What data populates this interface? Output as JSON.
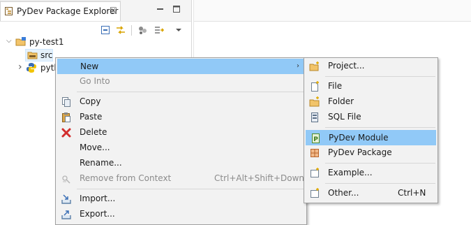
{
  "view": {
    "tab_title": "PyDev Package Explorer",
    "tab_close": "☒"
  },
  "tree": {
    "project": {
      "label": "py-test1",
      "twist": "⌵"
    },
    "src": {
      "label": "src"
    },
    "python": {
      "label": "pytl",
      "twist": "›"
    }
  },
  "context_menu": {
    "items": [
      {
        "label": "New",
        "submenu_arrow": "›"
      },
      {
        "label": "Go Into"
      },
      {
        "label": "Copy"
      },
      {
        "label": "Paste"
      },
      {
        "label": "Delete"
      },
      {
        "label": "Move..."
      },
      {
        "label": "Rename..."
      },
      {
        "label": "Remove from Context",
        "accelerator": "Ctrl+Alt+Shift+Down"
      },
      {
        "label": "Import..."
      },
      {
        "label": "Export..."
      }
    ]
  },
  "new_submenu": {
    "items": [
      {
        "label": "Project..."
      },
      {
        "label": "File"
      },
      {
        "label": "Folder"
      },
      {
        "label": "SQL File"
      },
      {
        "label": "PyDev Module"
      },
      {
        "label": "PyDev Package"
      },
      {
        "label": "Example..."
      },
      {
        "label": "Other...",
        "accelerator": "Ctrl+N"
      }
    ]
  },
  "colors": {
    "selection": "#91c9f7",
    "menu_bg": "#f2f2f2",
    "disabled_text": "#8b8b8b"
  }
}
